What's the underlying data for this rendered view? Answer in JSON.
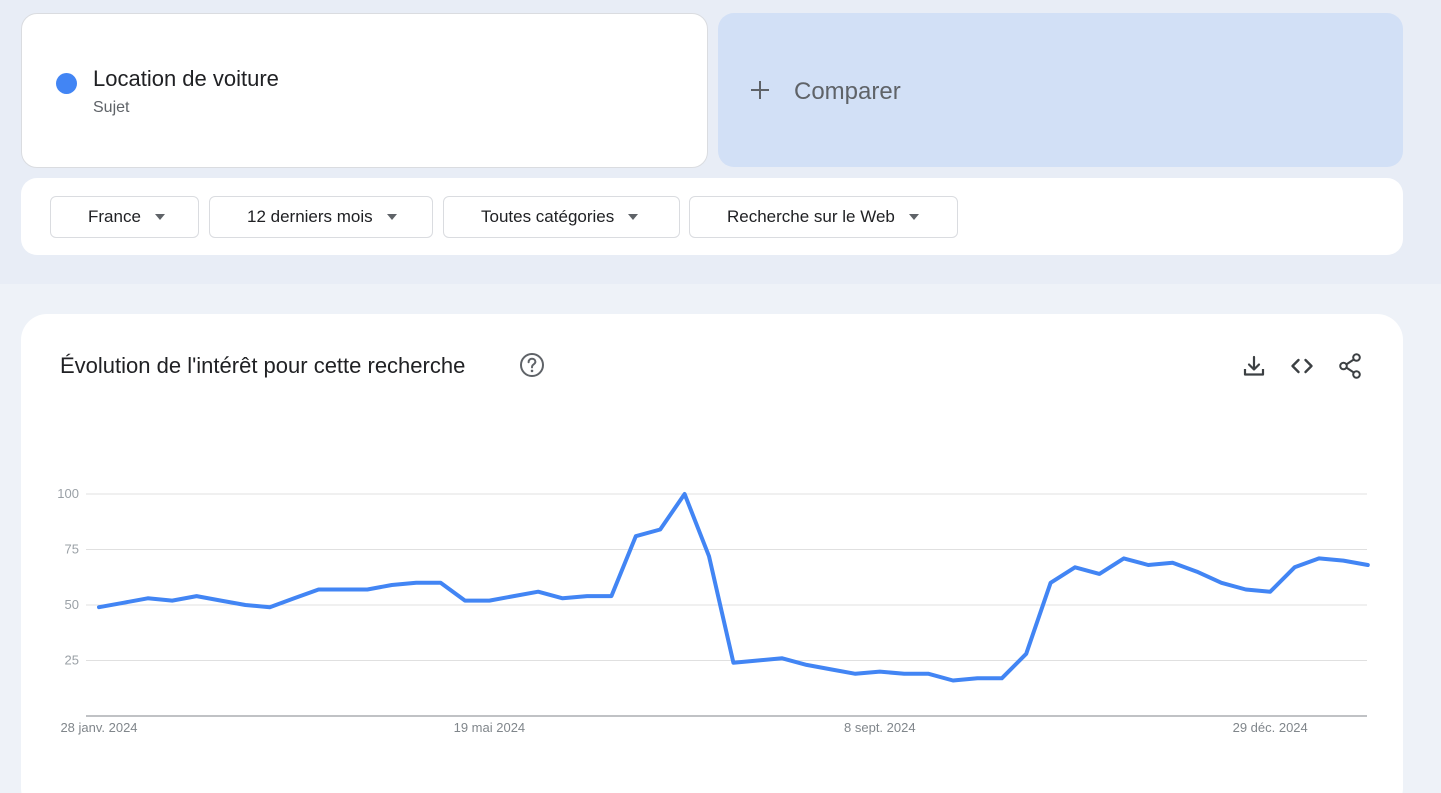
{
  "term": {
    "name": "Location de voiture",
    "type": "Sujet",
    "color": "#4285f4"
  },
  "compare": {
    "label": "Comparer",
    "icon": "plus-icon"
  },
  "filters": [
    {
      "label": "France",
      "icon": "caret-down-icon"
    },
    {
      "label": "12 derniers mois",
      "icon": "caret-down-icon"
    },
    {
      "label": "Toutes catégories",
      "icon": "caret-down-icon"
    },
    {
      "label": "Recherche sur le Web",
      "icon": "caret-down-icon"
    }
  ],
  "chart_section": {
    "title": "Évolution de l'intérêt pour cette recherche",
    "help_icon": "help-circle-icon",
    "actions": [
      "download-icon",
      "embed-code-icon",
      "share-icon"
    ]
  },
  "chart_data": {
    "type": "line",
    "title": "Évolution de l'intérêt pour cette recherche",
    "xlabel": "",
    "ylabel": "",
    "ylim": [
      0,
      100
    ],
    "y_ticks": [
      25,
      50,
      75,
      100
    ],
    "x_tick_labels": [
      "28 janv. 2024",
      "19 mai 2024",
      "8 sept. 2024",
      "29 déc. 2024"
    ],
    "x_tick_indices": [
      0,
      16,
      32,
      48
    ],
    "grid": true,
    "series_color": "#4285f4",
    "series": [
      {
        "values": [
          49,
          51,
          53,
          52,
          54,
          52,
          50,
          49,
          53,
          57,
          57,
          57,
          59,
          60,
          60,
          52,
          52,
          54,
          56,
          53,
          54,
          54,
          81,
          84,
          100,
          72,
          24,
          25,
          26,
          23,
          21,
          19,
          20,
          19,
          19,
          16,
          17,
          17,
          28,
          60,
          67,
          64,
          71,
          68,
          69,
          65,
          60,
          57,
          56,
          67,
          71,
          70,
          68
        ]
      }
    ]
  }
}
